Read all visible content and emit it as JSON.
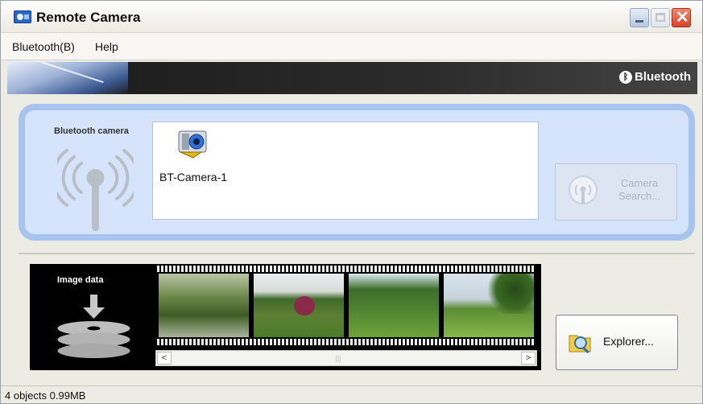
{
  "window": {
    "title": "Remote Camera"
  },
  "menu": {
    "bluetooth": "Bluetooth(B)",
    "help": "Help"
  },
  "banner": {
    "brand": "Bluetooth"
  },
  "camera_section": {
    "label": "Bluetooth camera",
    "devices": [
      {
        "name": "BT-Camera-1",
        "icon": "bt-camera-icon"
      }
    ],
    "search_button": {
      "label": "Camera Search..."
    }
  },
  "image_section": {
    "label": "Image data",
    "thumbnails_count": 4,
    "explorer_button": {
      "label": "Explorer..."
    }
  },
  "status": {
    "text": "4 objects 0.99MB"
  },
  "colors": {
    "panel_border": "#a7c4ee",
    "panel_fill": "#d5e4fa",
    "close_button": "#d8432a"
  }
}
